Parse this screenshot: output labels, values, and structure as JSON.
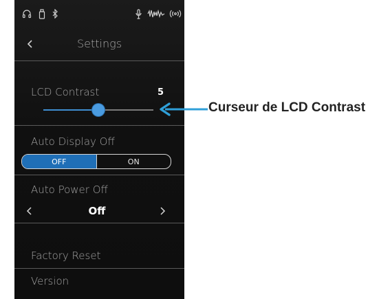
{
  "status_bar": {
    "icons": [
      "headphones-icon",
      "usb-drive-icon",
      "bluetooth-icon",
      "microphone-icon",
      "sound-wave-icon",
      "wireless-icon"
    ]
  },
  "header": {
    "title": "Settings"
  },
  "lcd_contrast": {
    "label": "LCD Contrast",
    "value": "5",
    "level_fraction": 0.5
  },
  "auto_display_off": {
    "label": "Auto Display Off",
    "options": [
      "OFF",
      "ON"
    ],
    "selected": "OFF"
  },
  "auto_power_off": {
    "label": "Auto Power Off",
    "value": "Off"
  },
  "factory_reset": {
    "label": "Factory Reset"
  },
  "version": {
    "label": "Version"
  },
  "annotation": {
    "text": "Curseur de LCD Contrast",
    "arrow_color": "#2f9fd8"
  },
  "colors": {
    "accent": "#1f6fb7",
    "thumb": "#4a9be0",
    "background": "#141414"
  }
}
